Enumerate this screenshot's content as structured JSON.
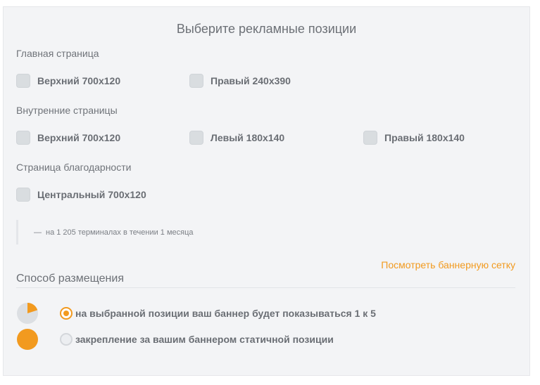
{
  "title": "Выберите рекламные позиции",
  "sections": {
    "main": {
      "label": "Главная страница",
      "options": [
        "Верхний 700x120",
        "Правый 240x390"
      ]
    },
    "inner": {
      "label": "Внутренние страницы",
      "options": [
        "Верхний 700x120",
        "Левый 180x140",
        "Правый 180x140"
      ]
    },
    "thanks": {
      "label": "Страница благодарности",
      "options": [
        "Центральный 700x120"
      ]
    }
  },
  "note": {
    "dash": "—",
    "text": "на 1 205 терминалах в течении 1 месяца"
  },
  "banner_grid_link": "Посмотреть баннерную сетку",
  "placement": {
    "title": "Способ размещения",
    "options": [
      {
        "label": "на выбранной позиции ваш баннер будет показываться 1 к 5",
        "selected": true,
        "share": 0.2,
        "icon": "pie-one-fifth-icon"
      },
      {
        "label": "закрепление за вашим баннером статичной позиции",
        "selected": false,
        "share": 1.0,
        "icon": "pie-full-icon"
      }
    ]
  },
  "colors": {
    "accent": "#f29a1f",
    "pie_rest": "#dcdfe3",
    "checkbox": "#d9dde0",
    "panel": "#f3f4f6"
  }
}
